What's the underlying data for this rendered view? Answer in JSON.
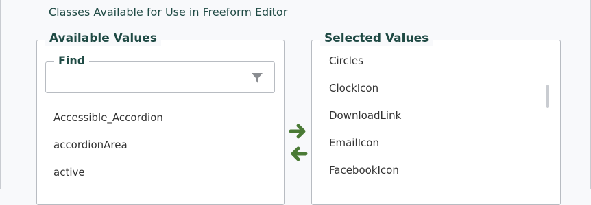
{
  "section_title": "Classes Available for Use in Freeform Editor",
  "available": {
    "legend": "Available Values",
    "find": {
      "legend": "Find",
      "value": "",
      "placeholder": ""
    },
    "items": [
      {
        "label": "Accessible_Accordion"
      },
      {
        "label": "accordionArea"
      },
      {
        "label": "active"
      }
    ]
  },
  "selected": {
    "legend": "Selected Values",
    "items": [
      {
        "label": "Circles"
      },
      {
        "label": "ClockIcon"
      },
      {
        "label": "DownloadLink"
      },
      {
        "label": "EmailIcon"
      },
      {
        "label": "FacebookIcon"
      }
    ]
  },
  "icons": {
    "filter": "filter-icon",
    "move_right": "arrow-right-icon",
    "move_left": "arrow-left-icon"
  },
  "colors": {
    "accent_green": "#4a7a35",
    "heading": "#1f4a44",
    "border": "#b8bcc2",
    "icon_gray": "#8a8d91"
  }
}
